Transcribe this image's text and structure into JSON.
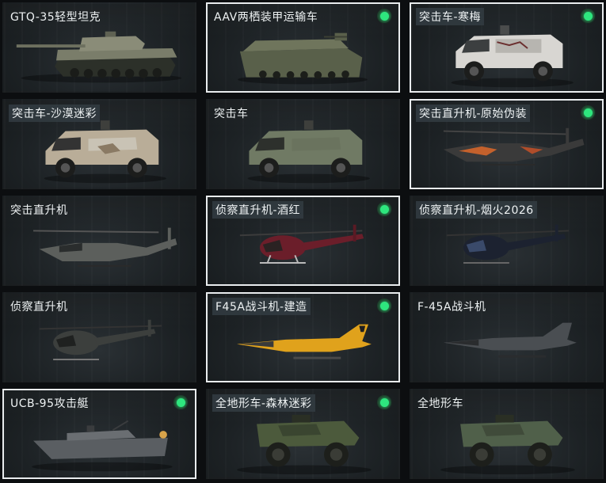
{
  "cards": [
    {
      "title": "GTQ-35轻型坦克",
      "selected": false,
      "owned": false,
      "vehicle": "light-tank",
      "pill": false
    },
    {
      "title": "AAV两栖装甲运输车",
      "selected": true,
      "owned": true,
      "vehicle": "amphibious-apc",
      "pill": false
    },
    {
      "title": "突击车-寒梅",
      "selected": true,
      "owned": true,
      "vehicle": "assault-car",
      "pill": true,
      "color": "#d8d6d2"
    },
    {
      "title": "突击车-沙漠迷彩",
      "selected": false,
      "owned": false,
      "vehicle": "assault-car",
      "pill": true,
      "color": "#b9ad98"
    },
    {
      "title": "突击车",
      "selected": false,
      "owned": false,
      "vehicle": "assault-car",
      "pill": false,
      "color": "#707a64"
    },
    {
      "title": "突击直升机-原始伪装",
      "selected": true,
      "owned": true,
      "vehicle": "attack-helicopter",
      "pill": true,
      "color": "#3a3a3a"
    },
    {
      "title": "突击直升机",
      "selected": false,
      "owned": false,
      "vehicle": "attack-helicopter",
      "pill": false,
      "color": "#5c5f5c"
    },
    {
      "title": "侦察直升机-酒红",
      "selected": true,
      "owned": true,
      "vehicle": "scout-helicopter",
      "pill": true,
      "color": "#6b1e2a"
    },
    {
      "title": "侦察直升机-烟火2026",
      "selected": false,
      "owned": false,
      "vehicle": "scout-helicopter",
      "pill": true,
      "color": "#1c2230"
    },
    {
      "title": "侦察直升机",
      "selected": false,
      "owned": false,
      "vehicle": "scout-helicopter",
      "pill": false,
      "color": "#3c3f3d"
    },
    {
      "title": "F45A战斗机-建造",
      "selected": true,
      "owned": true,
      "vehicle": "fighter-jet",
      "pill": true,
      "color": "#e0a21c"
    },
    {
      "title": "F-45A战斗机",
      "selected": false,
      "owned": false,
      "vehicle": "fighter-jet",
      "pill": false,
      "color": "#4a4e52"
    },
    {
      "title": "UCB-95攻击艇",
      "selected": true,
      "owned": true,
      "vehicle": "attack-boat",
      "pill": false,
      "color": "#5a5e62"
    },
    {
      "title": "全地形车-森林迷彩",
      "selected": false,
      "owned": true,
      "vehicle": "atv",
      "pill": true,
      "color": "#4c5a3c"
    },
    {
      "title": "全地形车",
      "selected": false,
      "owned": false,
      "vehicle": "atv",
      "pill": false,
      "color": "#50604a"
    }
  ]
}
